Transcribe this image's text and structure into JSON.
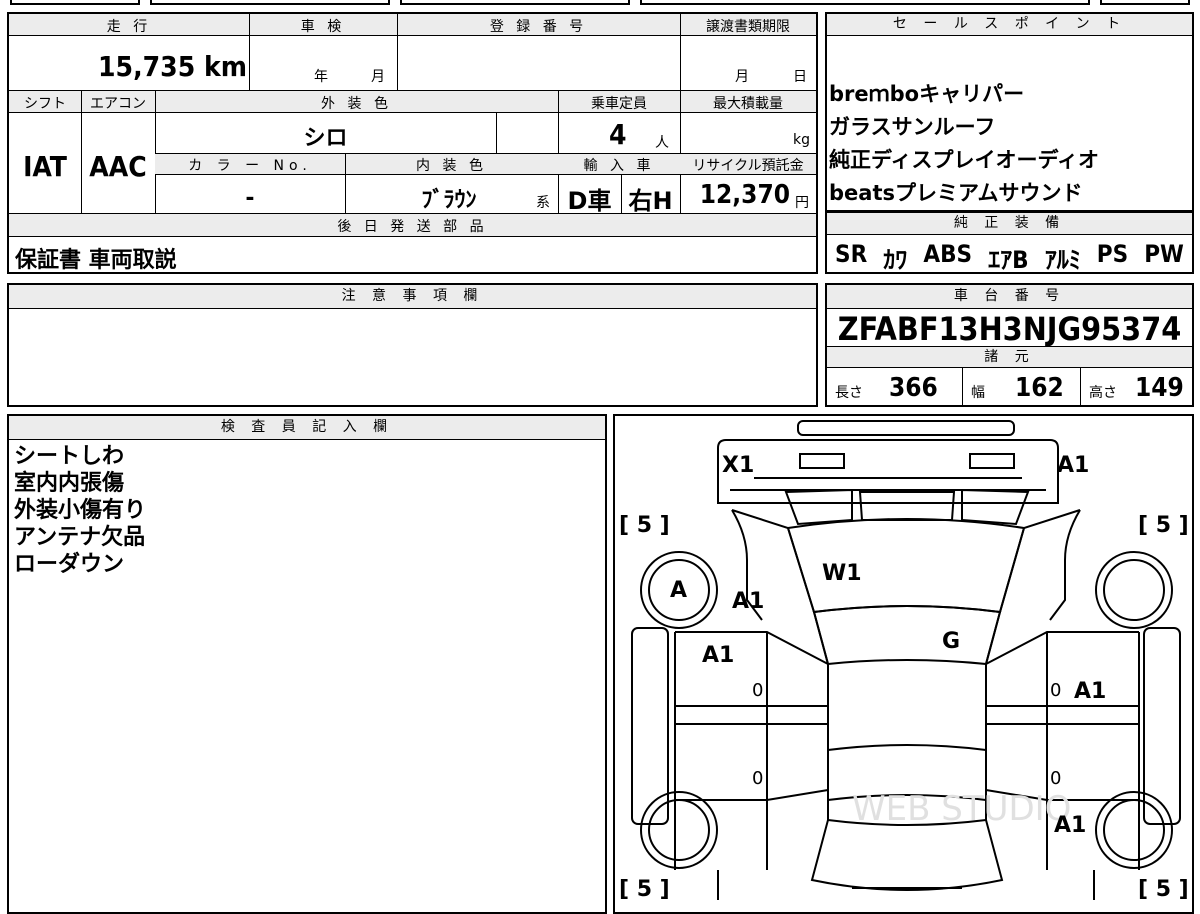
{
  "summary": {
    "mileage_label": "走 行",
    "mileage_value": "15,735 km",
    "inspection_label": "車 検",
    "inspection_year": "年",
    "inspection_month": "月",
    "registration_label": "登 録 番 号",
    "transfer_label": "譲渡書類期限",
    "transfer_month": "月",
    "transfer_day": "日",
    "shift_label": "シフト",
    "shift_value": "IAT",
    "ac_label": "エアコン",
    "ac_value": "AAC",
    "exterior_label": "外 装 色",
    "exterior_value": "シロ",
    "capacity_label": "乗車定員",
    "capacity_value": "4",
    "capacity_unit": "人",
    "loadcap_label": "最大積載量",
    "loadcap_unit": "kg",
    "colorno_label": "カ ラ ー No.",
    "colorno_value": "-",
    "interior_label": "内 装 色",
    "interior_value": "ﾌﾞﾗｳﾝ",
    "interior_suffix": "系",
    "import_label": "輸 入 車",
    "import_value": "D車",
    "handle_value": "右H",
    "recycle_label": "リサイクル預託金",
    "recycle_value": "12,370",
    "recycle_unit": "円",
    "later_parts_label": "後 日 発 送 部 品",
    "later_parts_value": "保証書 車両取説"
  },
  "sales_points": {
    "label": "セ ー ル ス ポ イ ン ト",
    "items": [
      "breｍboキャリパー",
      "ガラスサンルーフ",
      "純正ディスプレイオーディオ",
      "beatsプレミアムサウンド"
    ]
  },
  "equipment": {
    "label": "純 正 装 備",
    "items": [
      "SR",
      "ｶﾜ",
      "ABS",
      "ｴｱB",
      "ｱﾙﾐ",
      "PS",
      "PW"
    ]
  },
  "caution": {
    "label": "注 意 事 項 欄",
    "text": ""
  },
  "chassis": {
    "label": "車 台 番 号",
    "number": "ZFABF13H3NJG95374",
    "specs_label": "諸 元",
    "length_label": "長さ",
    "length_value": "366",
    "width_label": "幅",
    "width_value": "162",
    "height_label": "高さ",
    "height_value": "149"
  },
  "inspector": {
    "label": "検 査 員 記 入 欄",
    "notes": [
      "シートしわ",
      "室内内張傷",
      "外装小傷有り",
      "アンテナ欠品",
      "ローダウン"
    ]
  },
  "diagram": {
    "marks": {
      "front_left": "X1",
      "front_right": "A1",
      "windshield": "W1",
      "left_wheel": "A",
      "left_fender": "A1",
      "left_door_front": "A1",
      "glass_roof": "G",
      "right_door_front": "A1",
      "right_rear": "A1",
      "door_zero_1": "0",
      "door_zero_2": "0",
      "door_zero_3": "0",
      "door_zero_4": "0"
    },
    "tire_left_front": "[ 5 ]",
    "tire_right_front": "[ 5 ]",
    "tire_left_rear": "[ 5 ]",
    "tire_right_rear": "[ 5 ]",
    "watermark": "WEB STUDIO"
  }
}
